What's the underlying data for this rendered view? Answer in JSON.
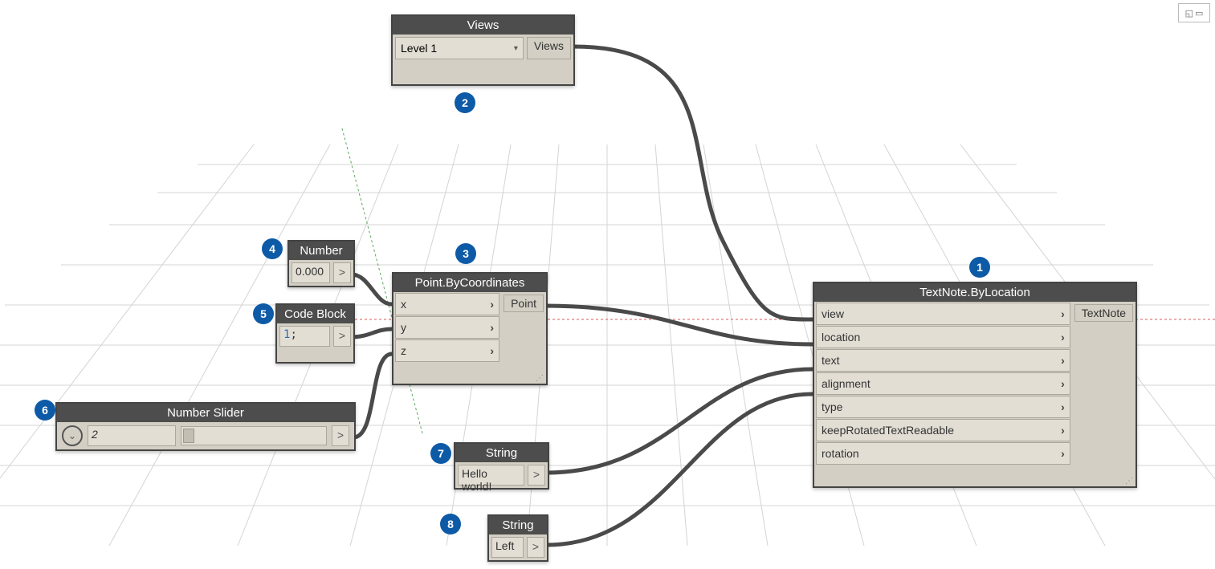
{
  "badges": [
    "1",
    "2",
    "3",
    "4",
    "5",
    "6",
    "7",
    "8"
  ],
  "nodes": {
    "views": {
      "title": "Views",
      "selected": "Level 1",
      "output": "Views"
    },
    "number": {
      "title": "Number",
      "value": "0.000"
    },
    "codeblock": {
      "title": "Code Block",
      "value": "1"
    },
    "slider": {
      "title": "Number Slider",
      "value": "2"
    },
    "point": {
      "title": "Point.ByCoordinates",
      "inputs": [
        "x",
        "y",
        "z"
      ],
      "output": "Point"
    },
    "string1": {
      "title": "String",
      "value": "Hello world!"
    },
    "string2": {
      "title": "String",
      "value": "Left"
    },
    "textnote": {
      "title": "TextNote.ByLocation",
      "inputs": [
        "view",
        "location",
        "text",
        "alignment",
        "type",
        "keepRotatedTextReadable",
        "rotation"
      ],
      "output": "TextNote"
    }
  },
  "connections": [
    {
      "from": "views.output",
      "to": "textnote.view"
    },
    {
      "from": "number.output",
      "to": "point.x"
    },
    {
      "from": "codeblock.output",
      "to": "point.y"
    },
    {
      "from": "slider.output",
      "to": "point.z"
    },
    {
      "from": "point.output",
      "to": "textnote.location"
    },
    {
      "from": "string1.output",
      "to": "textnote.text"
    },
    {
      "from": "string2.output",
      "to": "textnote.alignment"
    }
  ]
}
